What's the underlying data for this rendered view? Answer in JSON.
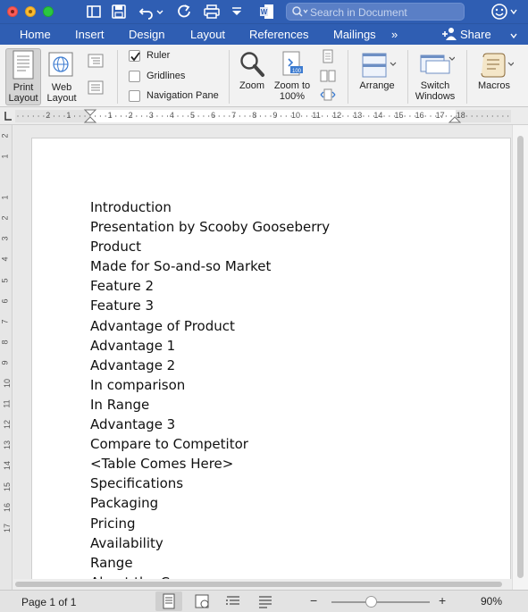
{
  "window": {
    "search_placeholder": "Search in Document"
  },
  "tabs": [
    "Home",
    "Insert",
    "Design",
    "Layout",
    "References",
    "Mailings"
  ],
  "tabs_overflow": "»",
  "share_label": "Share",
  "ribbon": {
    "print_layout": "Print Layout",
    "web_layout": "Web Layout",
    "ruler": "Ruler",
    "gridlines": "Gridlines",
    "navigation_pane": "Navigation Pane",
    "ruler_checked": true,
    "gridlines_checked": false,
    "navigation_pane_checked": false,
    "zoom": "Zoom",
    "zoom_to_100_line1": "Zoom to",
    "zoom_to_100_line2": "100%",
    "arrange": "Arrange",
    "switch_windows_line1": "Switch",
    "switch_windows_line2": "Windows",
    "macros": "Macros",
    "print_layout_line1": "Print",
    "print_layout_line2": "Layout",
    "web_layout_line1": "Web",
    "web_layout_line2": "Layout"
  },
  "ruler_numbers": [
    "2",
    "1",
    "1",
    "2",
    "3",
    "4",
    "5",
    "6",
    "7",
    "8",
    "9",
    "10",
    "11",
    "12",
    "13",
    "14",
    "15",
    "16",
    "17",
    "18"
  ],
  "vruler_numbers": [
    "2",
    "1",
    "1",
    "2",
    "3",
    "4",
    "5",
    "6",
    "7",
    "8",
    "9",
    "10",
    "11",
    "12",
    "13",
    "14",
    "15",
    "16",
    "17"
  ],
  "document": {
    "lines": [
      "Introduction",
      "Presentation by Scooby Gooseberry",
      "Product",
      "Made for So-and-so Market",
      "Feature 2",
      "Feature 3",
      "Advantage of Product",
      "Advantage 1",
      "Advantage 2",
      "In comparison",
      "In Range",
      "Advantage 3",
      "Compare to Competitor",
      "<Table Comes Here>",
      "Specifications",
      "Packaging",
      "Pricing",
      "Availability",
      "Range",
      "About the Company"
    ]
  },
  "status": {
    "page_indicator": "Page 1 of 1",
    "zoom_minus": "−",
    "zoom_plus": "+",
    "zoom_level": "90%",
    "zoom_fraction": 0.4
  }
}
